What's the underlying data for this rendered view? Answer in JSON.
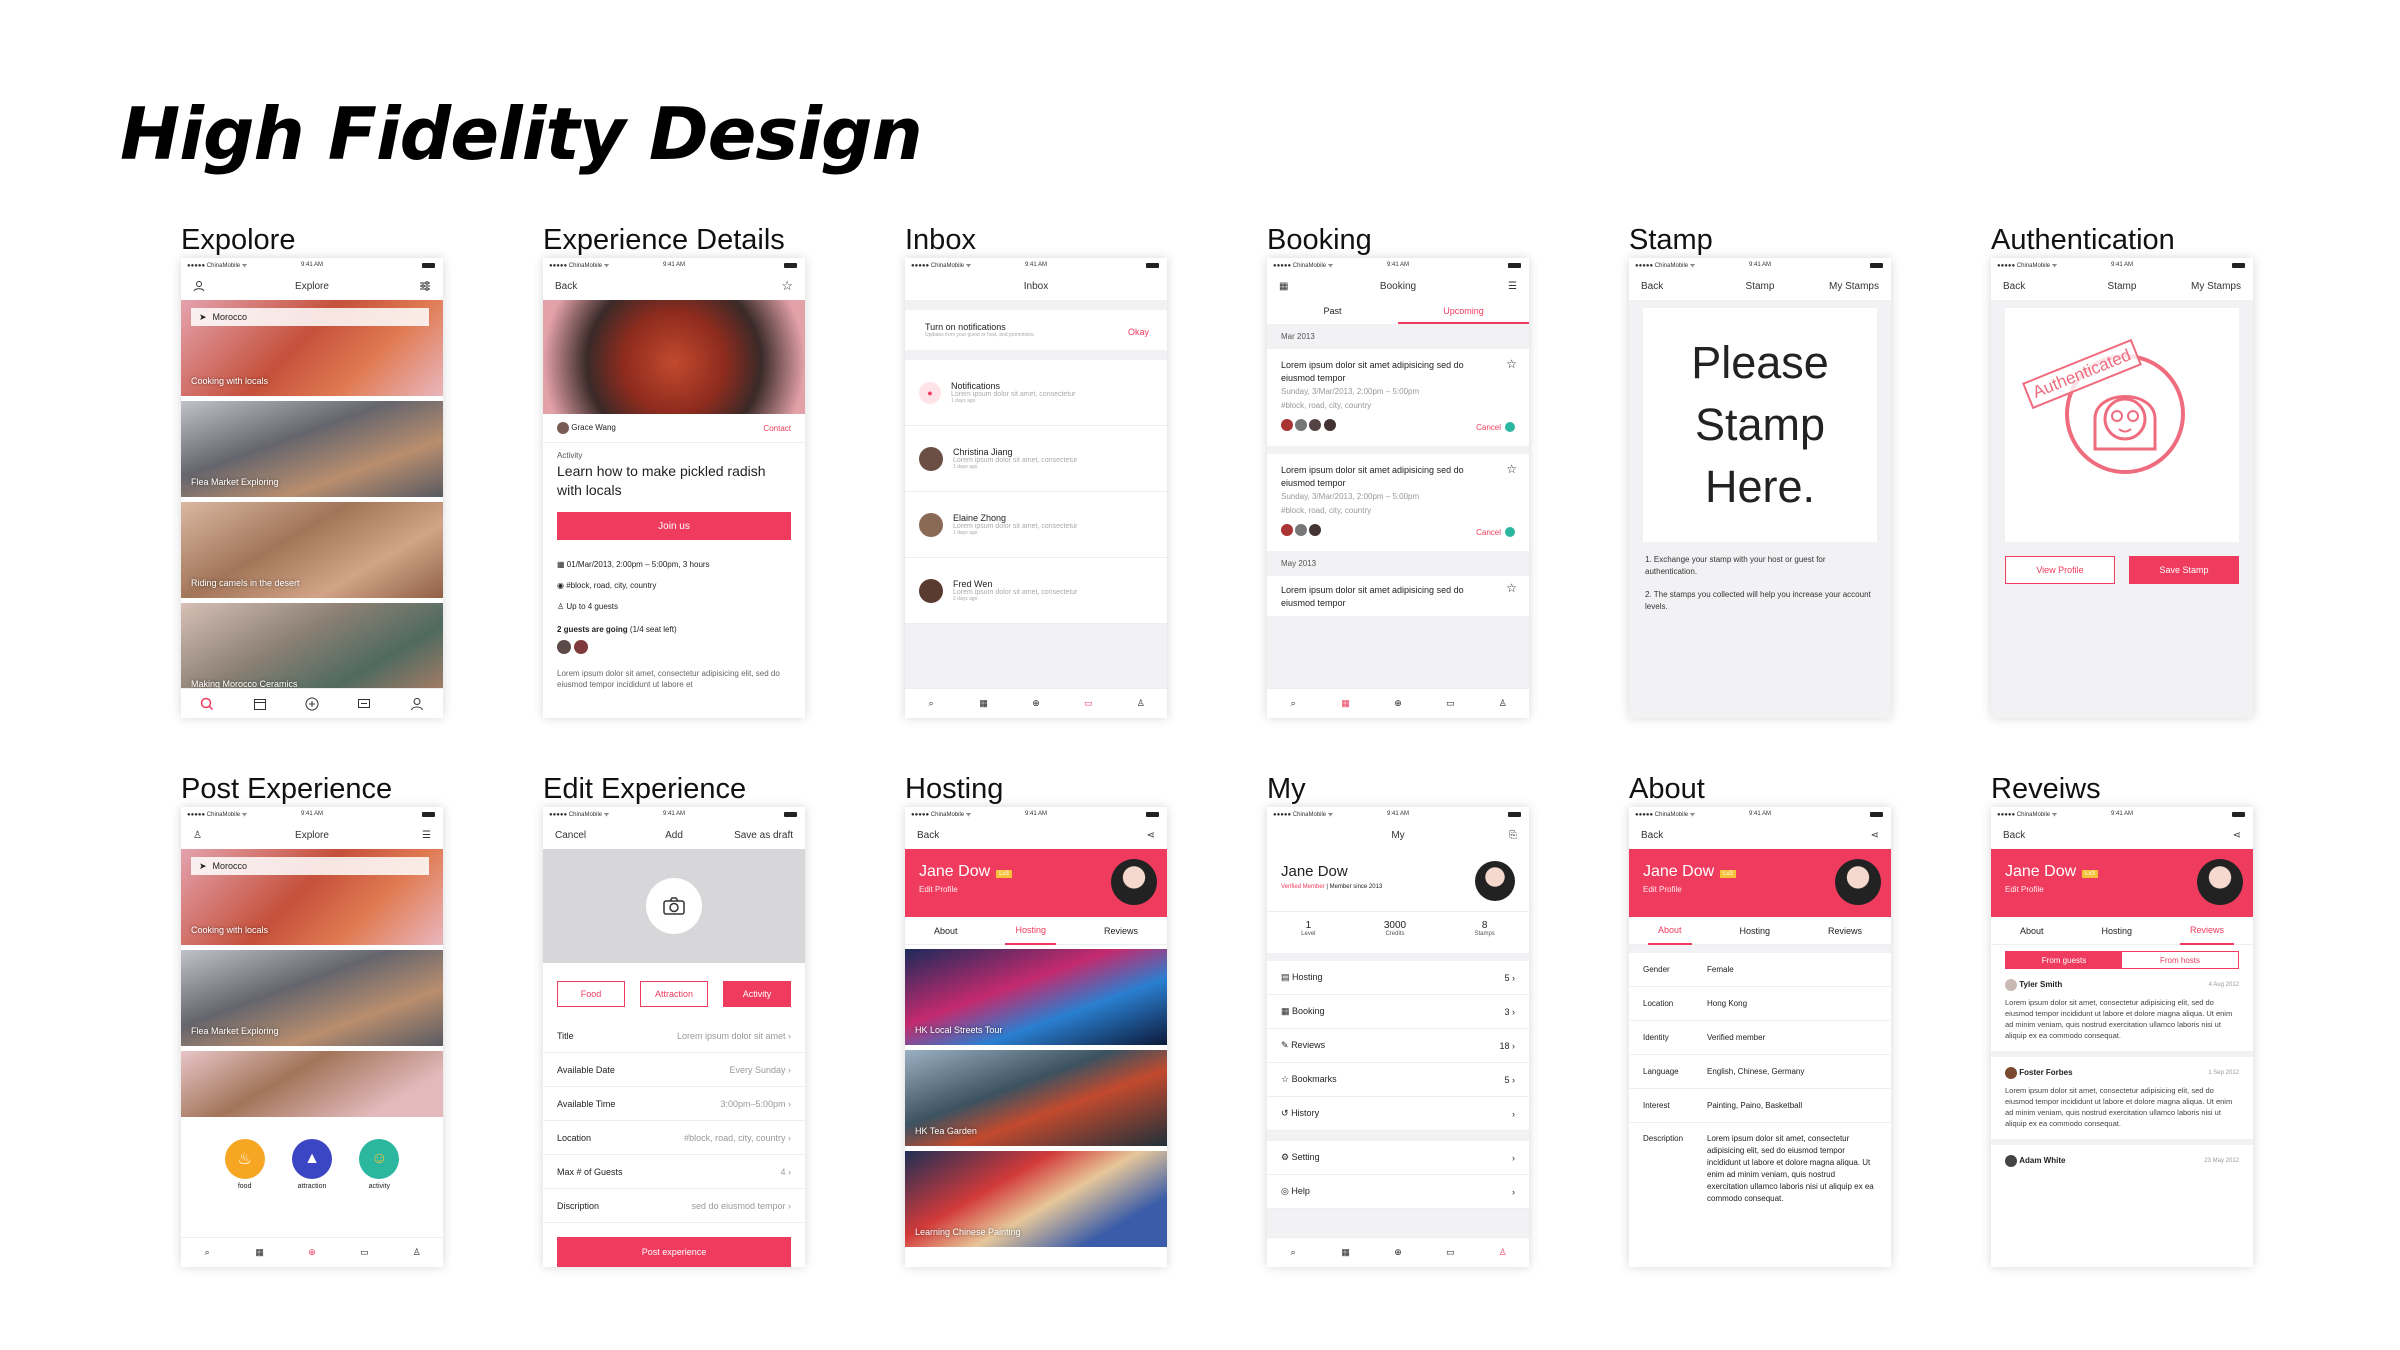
{
  "page_title": "High Fidelity Design",
  "status": {
    "carrier": "●●●●● ChinaMobile ᯤ",
    "time": "9:41 AM"
  },
  "screens": {
    "s1": "Expolore",
    "s2": "Experience Details",
    "s3": "Inbox",
    "s4": "Booking",
    "s5": "Stamp",
    "s6": "Authentication",
    "s7": "Post Experience",
    "s8": "Edit Experience",
    "s9": "Hosting",
    "s10": "My",
    "s11": "About",
    "s12": "Reveiws"
  },
  "explore": {
    "nav": "Explore",
    "search": "Morocco",
    "cards": [
      "Cooking with locals",
      "Flea Market Exploring",
      "Riding camels in the desert",
      "Making Morocco Ceramics"
    ]
  },
  "details": {
    "back": "Back",
    "host": "Grace Wang",
    "contact": "Contact",
    "kind": "Activity",
    "title": "Learn how to make pickled radish with locals",
    "join": "Join us",
    "date": "01/Mar/2013, 2:00pm – 5:00pm, 3 hours",
    "loc": "#block, road, city, country",
    "guests": "Up to 4 guests",
    "going": "2 guests are going",
    "seats": "(1/4 seat left)",
    "desc": "Lorem ipsum dolor sit amet, consectetur adipisicing elit, sed do eiusmod tempor incididunt ut labore et"
  },
  "inbox": {
    "nav": "Inbox",
    "notif_t": "Turn on notifications",
    "notif_s": "Updates from your guest or host, and promotions.",
    "okay": "Okay",
    "items": [
      {
        "n": "Notifications",
        "p": "Lorem ipsum dolor sit amet, consectetur",
        "d": "1 days ago"
      },
      {
        "n": "Christina Jiang",
        "p": "Lorem ipsum dolor sit amet, consectetur",
        "d": "1 days ago"
      },
      {
        "n": "Elaine Zhong",
        "p": "Lorem ipsum dolor sit amet, consectetur",
        "d": "1 days ago"
      },
      {
        "n": "Fred Wen",
        "p": "Lorem ipsum dolor sit amet, consectetur",
        "d": "2 days ago"
      }
    ]
  },
  "booking": {
    "nav": "Booking",
    "past": "Past",
    "upcoming": "Upcoming",
    "m1": "Mar 2013",
    "m2": "May 2013",
    "title": "Lorem ipsum dolor sit amet adipisicing sed do eiusmod tempor",
    "date": "Sunday, 3/Mar/2013, 2:00pm – 5:00pm",
    "loc": "#block, road, city, country",
    "cancel": "Cancel"
  },
  "stamp": {
    "back": "Back",
    "stamp": "Stamp",
    "my": "My Stamps",
    "big": "Please Stamp Here.",
    "n1": "1. Exchange your stamp with your host or guest for authentication.",
    "n2": "2. The stamps you collected will help you increase your account levels."
  },
  "auth": {
    "badge": "Authenticated",
    "view": "View Profile",
    "save": "Save Stamp"
  },
  "post": {
    "nav": "Explore",
    "cats": [
      "food",
      "attraction",
      "activity"
    ]
  },
  "edit": {
    "cancel": "Cancel",
    "add": "Add",
    "draft": "Save as draft",
    "tags": [
      "Food",
      "Attraction",
      "Activity"
    ],
    "rows": [
      {
        "k": "Title",
        "v": "Lorem ipsum dolor sit amet"
      },
      {
        "k": "Available Date",
        "v": "Every Sunday"
      },
      {
        "k": "Available Time",
        "v": "3:00pm–5:00pm"
      },
      {
        "k": "Location",
        "v": "#block, road, city, country"
      },
      {
        "k": "Max # of Guests",
        "v": "4"
      },
      {
        "k": "Discription",
        "v": "sed do eiusmod tempor"
      }
    ],
    "post": "Post experience"
  },
  "hosting": {
    "back": "Back",
    "name": "Jane Dow",
    "lv": "Lv3",
    "edit": "Edit Profile",
    "tabs": [
      "About",
      "Hosting",
      "Reviews"
    ],
    "cards": [
      "HK Local Streets Tour",
      "HK Tea Garden",
      "Learning Chinese Painting"
    ]
  },
  "my": {
    "nav": "My",
    "name": "Jane Dow",
    "verified": "Verified Member",
    "since": "| Member since 2013",
    "stats": [
      {
        "v": "1",
        "k": "Level"
      },
      {
        "v": "3000",
        "k": "Credits"
      },
      {
        "v": "8",
        "k": "Stamps"
      }
    ],
    "items": [
      {
        "k": "Hosting",
        "v": "5"
      },
      {
        "k": "Booking",
        "v": "3"
      },
      {
        "k": "Reviews",
        "v": "18"
      },
      {
        "k": "Bookmarks",
        "v": "5"
      },
      {
        "k": "History",
        "v": ""
      }
    ],
    "setting": "Setting",
    "help": "Help"
  },
  "about": {
    "rows": [
      {
        "k": "Gender",
        "v": "Female"
      },
      {
        "k": "Location",
        "v": "Hong Kong"
      },
      {
        "k": "Identity",
        "v": "Verified member"
      },
      {
        "k": "Language",
        "v": "English, Chinese, Germany"
      },
      {
        "k": "Interest",
        "v": "Painting, Paino, Basketball"
      }
    ],
    "desc_k": "Description",
    "desc": "Lorem ipsum dolor sit amet, consectetur adipisicing elit, sed do eiusmod tempor incididunt ut labore et dolore magna aliqua. Ut enim ad minim veniam, quis nostrud exercitation ullamco laboris nisi ut aliquip ex ea commodo consequat."
  },
  "reviews": {
    "from_guests": "From guests",
    "from_hosts": "From hosts",
    "items": [
      {
        "n": "Tyler Smith",
        "d": "4 Aug 2012"
      },
      {
        "n": "Foster Forbes",
        "d": "1 Sep 2012"
      },
      {
        "n": "Adam White",
        "d": "23 May 2012"
      }
    ],
    "text": "Lorem ipsum dolor sit amet, consectetur adipisicing elit, sed do eiusmod tempor incididunt ut labore et dolore magna aliqua. Ut enim ad minim veniam, quis nostrud exercitation ullamco laboris nisi ut aliquip ex ea commodo consequat."
  },
  "colors": {
    "accent": "#ef3b5e",
    "gold": "#f6c23b",
    "teal": "#2bb6a0"
  }
}
